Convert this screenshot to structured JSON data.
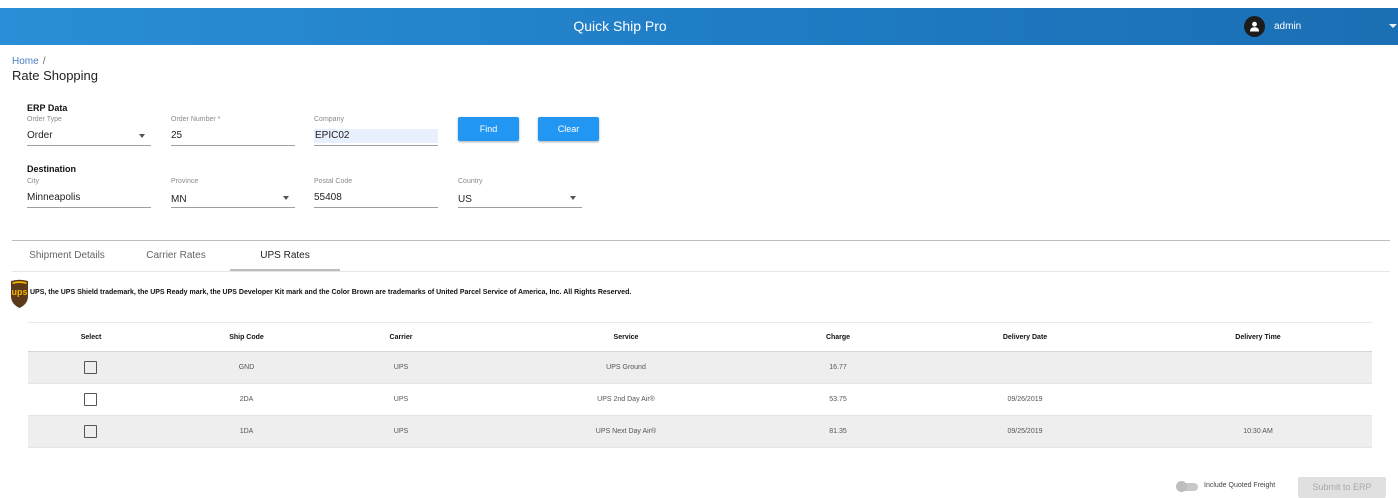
{
  "app": {
    "title": "Quick Ship Pro",
    "user": "admin"
  },
  "breadcrumb": {
    "home": "Home",
    "separator": "/"
  },
  "page": {
    "title": "Rate Shopping"
  },
  "erp": {
    "section": "ERP Data",
    "order_type": {
      "label": "Order Type",
      "value": "Order"
    },
    "order_number": {
      "label": "Order Number *",
      "value": "25"
    },
    "company": {
      "label": "Company",
      "value": "EPIC02"
    },
    "find_label": "Find",
    "clear_label": "Clear"
  },
  "destination": {
    "section": "Destination",
    "city": {
      "label": "City",
      "value": "Minneapolis"
    },
    "province": {
      "label": "Province",
      "value": "MN"
    },
    "postal": {
      "label": "Postal Code",
      "value": "55408"
    },
    "country": {
      "label": "Country",
      "value": "US"
    }
  },
  "tabs": [
    {
      "label": "Shipment Details"
    },
    {
      "label": "Carrier Rates"
    },
    {
      "label": "UPS Rates"
    }
  ],
  "ups_logo_text": "ups",
  "trademark": "UPS, the UPS Shield trademark, the UPS Ready mark, the UPS Developer Kit mark and the Color Brown are trademarks of United Parcel Service of America, Inc. All Rights Reserved.",
  "table": {
    "headers": [
      "Select",
      "Ship Code",
      "Carrier",
      "Service",
      "Charge",
      "Delivery Date",
      "Delivery Time"
    ],
    "rows": [
      {
        "code": "GND",
        "carrier": "UPS",
        "service": "UPS Ground",
        "charge": "16.77",
        "date": "",
        "time": ""
      },
      {
        "code": "2DA",
        "carrier": "UPS",
        "service": "UPS 2nd Day Air®",
        "charge": "53.75",
        "date": "09/26/2019",
        "time": ""
      },
      {
        "code": "1DA",
        "carrier": "UPS",
        "service": "UPS Next Day Air®",
        "charge": "81.35",
        "date": "09/25/2019",
        "time": "10:30 AM"
      }
    ]
  },
  "footer": {
    "toggle_label": "Include Quoted Freight",
    "submit_label": "Submit to ERP"
  },
  "colors": {
    "header": "#1f7cc4",
    "accent": "#2196f3",
    "ups_brown": "#5a3a1b",
    "ups_gold": "#f5b400"
  }
}
